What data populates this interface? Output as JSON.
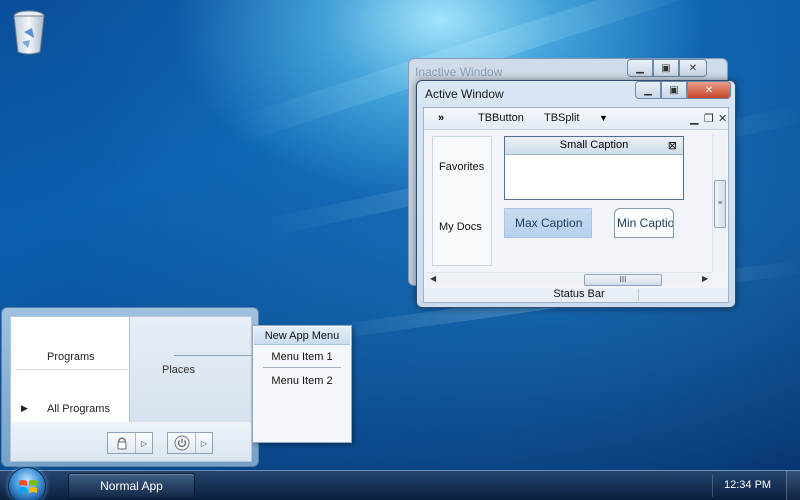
{
  "desktop": {
    "icons": [
      {
        "name": "recycle-bin-icon"
      }
    ]
  },
  "inactive_window": {
    "title": "Inactive Window",
    "caption_buttons": [
      "minimize",
      "maximize",
      "close"
    ]
  },
  "active_window": {
    "title": "Active Window",
    "toolbar": {
      "chevron": "»",
      "button_label": "TBButton",
      "split_label": "TBSplit"
    },
    "left_panel": [
      "Favorites",
      "My Docs"
    ],
    "small_caption": {
      "title": "Small Caption"
    },
    "max_caption": "Max Caption",
    "min_caption": "Min Captio",
    "scrollbar_grip": "III",
    "status_bar": "Status Bar",
    "colors": {
      "close_button": "#c8452a"
    }
  },
  "start_menu": {
    "programs_label": "Programs",
    "all_programs_label": "All Programs",
    "places_label": "Places"
  },
  "app_menu": {
    "header": "New App Menu",
    "items": [
      "Menu Item 1",
      "Menu Item 2"
    ]
  },
  "taskbar": {
    "task_button": "Normal App",
    "clock": "12:34 PM"
  }
}
